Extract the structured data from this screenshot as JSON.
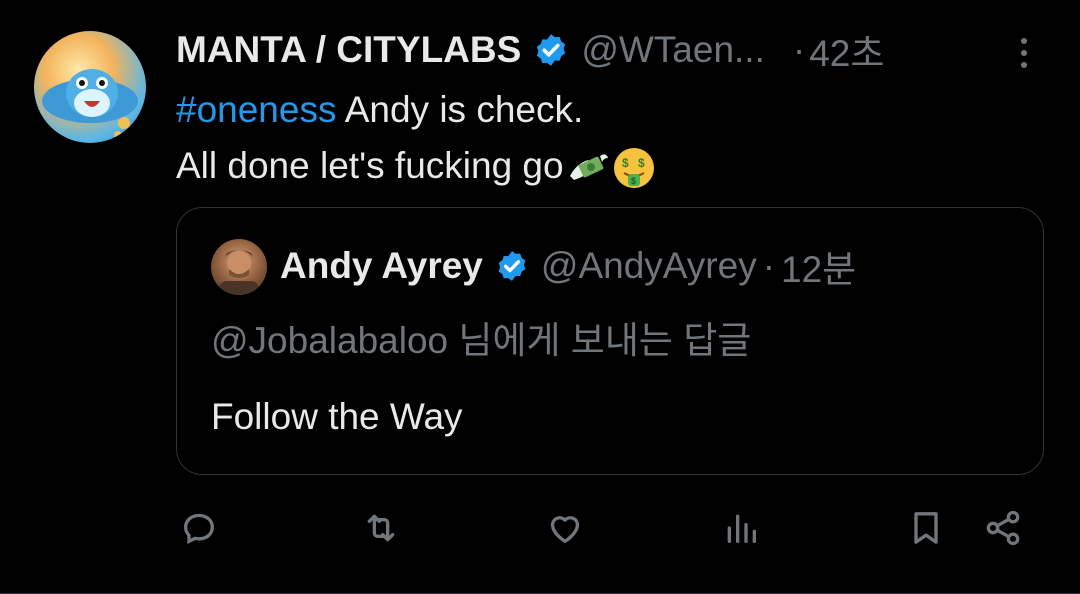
{
  "tweet": {
    "author_name": "MANTA / CITYLABS",
    "handle": "@WTaen...",
    "separator": "·",
    "time": "42초",
    "hashtag": "#oneness",
    "line1_rest": " Andy is check.",
    "line2": "All done let's fucking go",
    "emojis": [
      "money-with-wings-emoji",
      "money-mouth-face-emoji"
    ]
  },
  "quote": {
    "author_name": "Andy Ayrey",
    "handle": "@AndyAyrey",
    "separator": "·",
    "time": "12분",
    "reply_to": "@Jobalabaloo 님에게 보내는 답글",
    "text": "Follow the Way"
  },
  "actions": [
    "reply-icon",
    "retweet-icon",
    "like-icon",
    "views-icon",
    "bookmark-icon",
    "share-icon"
  ],
  "colors": {
    "background": "#000000",
    "text": "#e7e9ea",
    "muted": "#71767b",
    "accent": "#1d9bf0",
    "border": "#2f3336"
  }
}
